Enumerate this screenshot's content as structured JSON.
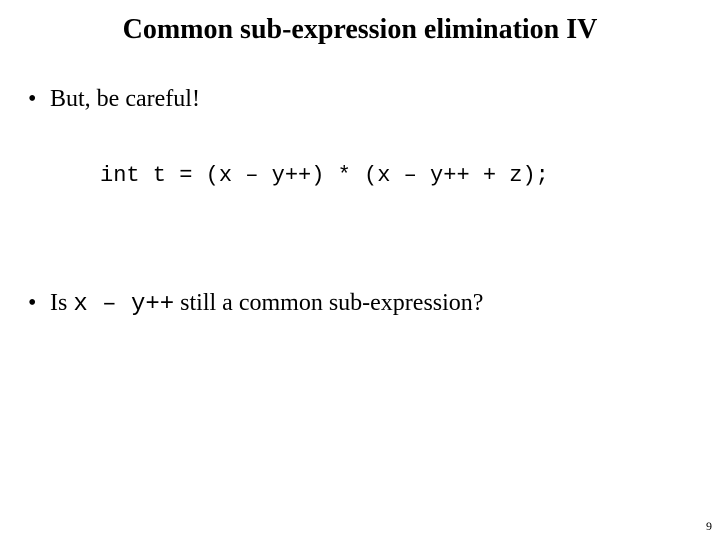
{
  "title": "Common sub-expression elimination IV",
  "bullets": {
    "b1": {
      "dot": "•",
      "text": "But, be careful!"
    },
    "b2": {
      "dot": "•",
      "pre": "Is ",
      "code": "x – y++",
      "post": " still a common sub-expression?"
    }
  },
  "code": "int t = (x – y++) * (x – y++ + z);",
  "page_number": "9"
}
